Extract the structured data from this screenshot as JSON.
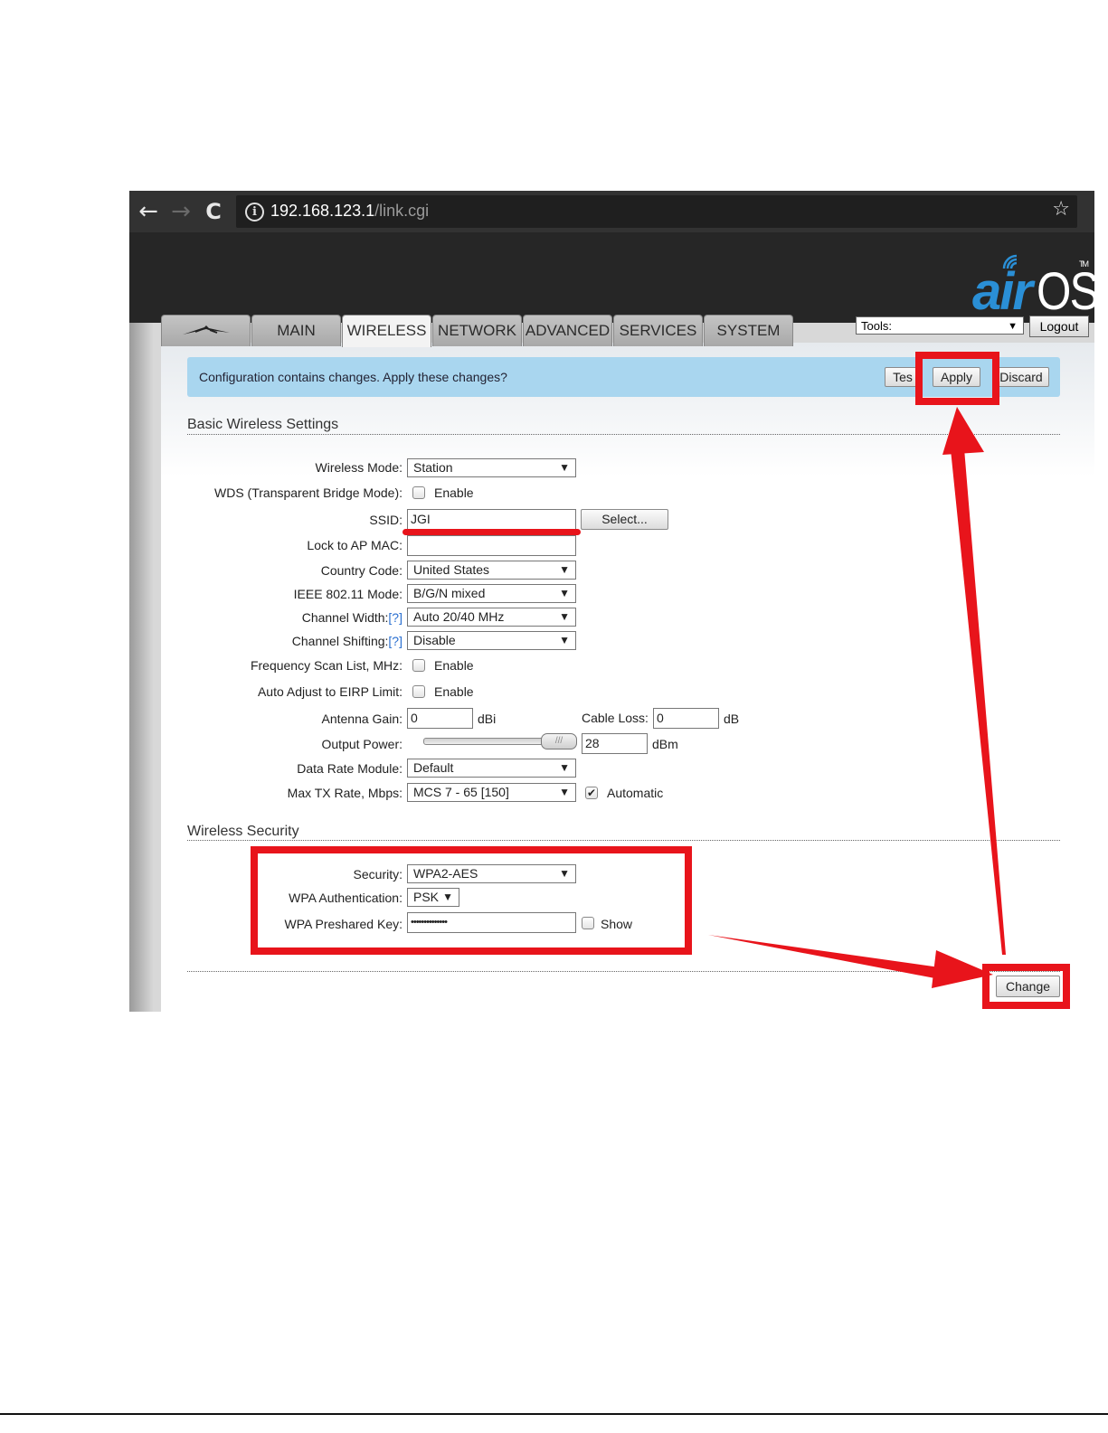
{
  "browser": {
    "url_host": "192.168.123.1",
    "url_path": "/link.cgi",
    "back_glyph": "←",
    "forward_glyph": "→",
    "reload_glyph": "C",
    "info_glyph": "i",
    "star_glyph": "☆"
  },
  "logo": {
    "air": "air",
    "os": "OS",
    "tm": "TM"
  },
  "tabs": [
    "MAIN",
    "WIRELESS",
    "NETWORK",
    "ADVANCED",
    "SERVICES",
    "SYSTEM"
  ],
  "active_tab": "WIRELESS",
  "tools": {
    "value": "Tools:",
    "arrow": "▼"
  },
  "logout_label": "Logout",
  "notice": {
    "text": "Configuration contains changes. Apply these changes?",
    "test_label": "Tes",
    "apply_label": "Apply",
    "discard_label": "Discard"
  },
  "basic": {
    "title": "Basic Wireless Settings",
    "wireless_mode_label": "Wireless Mode:",
    "wireless_mode_value": "Station",
    "wds_label": "WDS (Transparent Bridge Mode):",
    "enable": "Enable",
    "ssid_label": "SSID:",
    "ssid_value": "JGI",
    "select_label": "Select...",
    "lock_label": "Lock to AP MAC:",
    "lock_value": "",
    "country_label": "Country Code:",
    "country_value": "United States",
    "ieee_label": "IEEE 802.11 Mode:",
    "ieee_value": "B/G/N mixed",
    "chwidth_label": "Channel Width:",
    "chwidth_value": "Auto 20/40 MHz",
    "chshift_label": "Channel Shifting:",
    "chshift_value": "Disable",
    "help": "[?]",
    "freqscan_label": "Frequency Scan List, MHz:",
    "eirp_label": "Auto Adjust to EIRP Limit:",
    "antenna_label": "Antenna Gain:",
    "antenna_value": "0",
    "antenna_unit": "dBi",
    "cable_label": "Cable Loss:",
    "cable_value": "0",
    "cable_unit": "dB",
    "power_label": "Output Power:",
    "power_value": "28",
    "power_unit": "dBm",
    "power_fraction": 1.0,
    "rate_module_label": "Data Rate Module:",
    "rate_module_value": "Default",
    "maxtx_label": "Max TX Rate, Mbps:",
    "maxtx_value": "MCS 7 - 65 [150]",
    "automatic_label": "Automatic",
    "automatic_check": "✔"
  },
  "security": {
    "title": "Wireless Security",
    "security_label": "Security:",
    "security_value": "WPA2-AES",
    "auth_label": "WPA Authentication:",
    "auth_value": "PSK",
    "psk_label": "WPA Preshared Key:",
    "psk_value": "••••••••••••••",
    "show_label": "Show"
  },
  "change_label": "Change",
  "dropdown_arrow": "▼",
  "colors": {
    "annotation_red": "#e8141b",
    "notice_blue": "#a9d6ef",
    "logo_blue": "#2a8fd6"
  }
}
